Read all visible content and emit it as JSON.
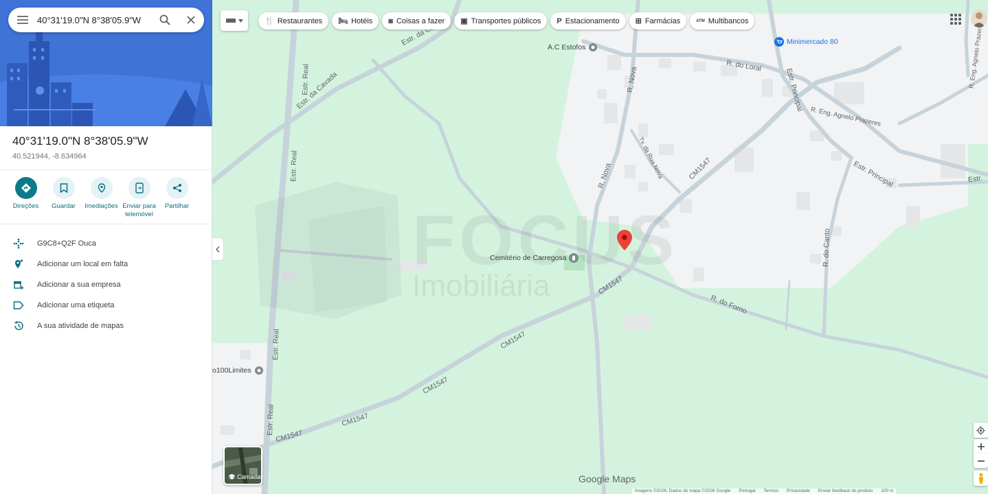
{
  "search": {
    "query": "40°31'19.0\"N 8°38'05.9\"W"
  },
  "place": {
    "coords_dms": "40°31'19.0\"N 8°38'05.9\"W",
    "coords_decimal": "40.521944, -8.634964"
  },
  "actions": [
    {
      "label": "Direções",
      "icon": "directions-icon"
    },
    {
      "label": "Guardar",
      "icon": "bookmark-icon"
    },
    {
      "label": "Imediações",
      "icon": "nearby-icon"
    },
    {
      "label": "Enviar para telemóvel",
      "icon": "send-to-phone-icon"
    },
    {
      "label": "Partilhar",
      "icon": "share-icon"
    }
  ],
  "info": [
    {
      "text": "G9C8+Q2F Ouca",
      "icon": "plus-code-icon"
    },
    {
      "text": "Adicionar um local em falta",
      "icon": "add-place-icon"
    },
    {
      "text": "Adicionar a sua empresa",
      "icon": "business-icon"
    },
    {
      "text": "Adicionar uma etiqueta",
      "icon": "label-icon"
    },
    {
      "text": "A sua atividade de mapas",
      "icon": "history-icon"
    }
  ],
  "chips": [
    {
      "label": "Restaurantes",
      "icon": "restaurant-icon",
      "glyph": "🍴"
    },
    {
      "label": "Hotéis",
      "icon": "hotel-icon",
      "glyph": "🛏"
    },
    {
      "label": "Coisas a fazer",
      "icon": "camera-icon",
      "glyph": "◙"
    },
    {
      "label": "Transportes públicos",
      "icon": "transit-icon",
      "glyph": "▣"
    },
    {
      "label": "Estacionamento",
      "icon": "parking-icon",
      "glyph": "P"
    },
    {
      "label": "Farmácias",
      "icon": "pharmacy-icon",
      "glyph": "⊞"
    },
    {
      "label": "Multibancos",
      "icon": "atm-icon",
      "glyph": "ATM"
    }
  ],
  "map": {
    "streets": {
      "estr_real_1": "Estr. Real",
      "estr_real_2": "Estr. Real",
      "estr_real_3": "Estr. Real",
      "estr_real_4": "Estr. Real",
      "estr_cavada_1": "Estr. da Cavada",
      "estr_cavada_2": "Estr. da Cavada",
      "r_nova_1": "R. Nova",
      "r_nova_2": "R. Nova",
      "tv_rua_nova": "Tv. da Rua Nova",
      "r_loral": "R. do Loral",
      "estr_principal_1": "Estr. Principal",
      "estr_principal_2": "Estr. Principal",
      "estr_principal_3": "Estr.",
      "r_eng_agnelo": "R. Eng. Agnelo Prazeres",
      "r_eng_agnelo_2": "R. Eng. Agnelo Prazeres",
      "cm1547_1": "CM1547",
      "cm1547_2": "CM1547",
      "cm1547_3": "CM1547",
      "cm1547_4": "CM1547",
      "cm1547_5": "CM1547",
      "cm1547_6": "CM1547",
      "r_forno": "R. do Forno",
      "r_canto": "R. do Canto"
    },
    "pois": {
      "estofos": "A.C Estofos",
      "minimercado": "Minimercado 80",
      "cemiterio": "Cemitério de Carregosa",
      "limites": "o100Limites"
    },
    "watermark_1": "FOCUS",
    "watermark_2": "Imobiliária",
    "layers_label": "Camadas",
    "brand": "Google Maps",
    "footer": [
      "Imagens ©2026, Dados do mapa ©2026 Google",
      "Portugal",
      "Termos",
      "Privacidade",
      "Enviar feedback do produto",
      "100 m"
    ]
  },
  "colors": {
    "map_green": "#d4f3df",
    "urban": "#f1f3f4",
    "road": "#c7d3da",
    "pin": "#ea4335",
    "accent": "#0b7a8a"
  }
}
